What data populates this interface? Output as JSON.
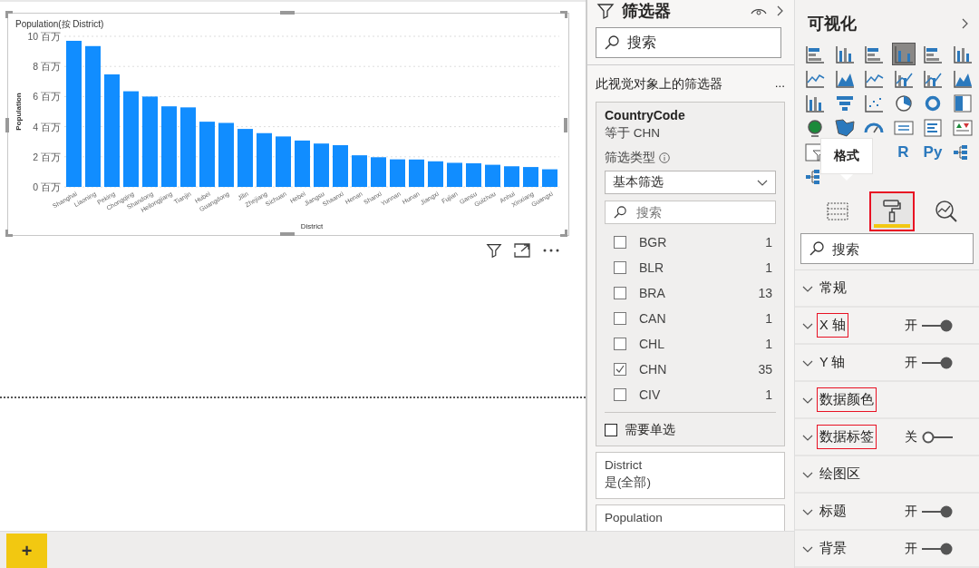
{
  "canvas": {
    "visual": {
      "title": "Population(按 District)",
      "chart_data": {
        "type": "bar",
        "grid": true,
        "xlabel": "District",
        "ylabel": "Population",
        "ylim": [
          0,
          10
        ],
        "yticks": [
          {
            "value": 0,
            "label": "0 百万"
          },
          {
            "value": 2,
            "label": "2 百万"
          },
          {
            "value": 4,
            "label": "4 百万"
          },
          {
            "value": 6,
            "label": "6 百万"
          },
          {
            "value": 8,
            "label": "8 百万"
          },
          {
            "value": 10,
            "label": "10 百万"
          }
        ],
        "categories": [
          "Shanghai",
          "Liaoning",
          "Peking",
          "Chongqing",
          "Shandong",
          "Heilongjiang",
          "Tianjin",
          "Hubei",
          "Guangdong",
          "Jilin",
          "Zhejiang",
          "Sichuan",
          "Hebei",
          "Jiangsu",
          "Shaanxi",
          "Henan",
          "Shanxi",
          "Yunnan",
          "Hunan",
          "Jiangxi",
          "Fujian",
          "Gansu",
          "Guizhou",
          "Anhui",
          "Xinxiang",
          "Guangxi"
        ],
        "series": [
          {
            "color": "#118dff",
            "values": [
              9.7,
              9.35,
              7.47,
              6.35,
              6.0,
              5.35,
              5.28,
              4.33,
              4.25,
              3.85,
              3.57,
              3.35,
              3.08,
              2.88,
              2.77,
              2.1,
              1.97,
              1.83,
              1.82,
              1.7,
              1.6,
              1.57,
              1.47,
              1.37,
              1.32,
              1.17
            ]
          }
        ]
      }
    }
  },
  "page_tabs": {
    "add_button": "+"
  },
  "filters": {
    "title": "筛选器",
    "search": {
      "placeholder": "搜索"
    },
    "section_title": "此视觉对象上的筛选器",
    "section_more": "...",
    "cards": [
      {
        "kind": "expanded",
        "field": "CountryCode",
        "summary": "等于 CHN",
        "filter_type_label": "筛选类型",
        "filter_type": "基本筛选",
        "search": {
          "placeholder": "搜索"
        },
        "items": [
          {
            "label": "BGR",
            "count": "1",
            "checked": false
          },
          {
            "label": "BLR",
            "count": "1",
            "checked": false
          },
          {
            "label": "BRA",
            "count": "13",
            "checked": false
          },
          {
            "label": "CAN",
            "count": "1",
            "checked": false
          },
          {
            "label": "CHL",
            "count": "1",
            "checked": false
          },
          {
            "label": "CHN",
            "count": "35",
            "checked": true
          },
          {
            "label": "CIV",
            "count": "1",
            "checked": false
          }
        ],
        "single_select": {
          "label": "需要单选",
          "checked": false
        }
      },
      {
        "kind": "collapsed",
        "field": "District",
        "summary": "是(全部)"
      },
      {
        "kind": "collapsed",
        "field": "Population"
      }
    ]
  },
  "visualizations": {
    "title": "可视化",
    "gallery": [
      {
        "kind": "hbar",
        "selected": false
      },
      {
        "kind": "vbar",
        "selected": false
      },
      {
        "kind": "hbar",
        "selected": false
      },
      {
        "kind": "vbar",
        "selected": true
      },
      {
        "kind": "hbar",
        "selected": false
      },
      {
        "kind": "vbar",
        "selected": false
      },
      {
        "kind": "line",
        "selected": false
      },
      {
        "kind": "area",
        "selected": false
      },
      {
        "kind": "line",
        "selected": false
      },
      {
        "kind": "combo",
        "selected": false
      },
      {
        "kind": "combo",
        "selected": false
      },
      {
        "kind": "area",
        "selected": false
      },
      {
        "kind": "vbar",
        "selected": false
      },
      {
        "kind": "funnel",
        "selected": false
      },
      {
        "kind": "scatter",
        "selected": false
      },
      {
        "kind": "pie",
        "selected": false
      },
      {
        "kind": "donut",
        "selected": false
      },
      {
        "kind": "treemap",
        "selected": false
      },
      {
        "kind": "globe",
        "selected": false
      },
      {
        "kind": "map",
        "selected": false
      },
      {
        "kind": "gauge",
        "selected": false
      },
      {
        "kind": "card",
        "selected": false
      },
      {
        "kind": "list",
        "selected": false
      },
      {
        "kind": "kpi",
        "selected": false
      },
      {
        "kind": "table",
        "selected": false
      },
      {
        "kind": "tooltip",
        "text": "格式"
      },
      {
        "kind": "blank"
      },
      {
        "kind": "text",
        "text": "R",
        "selected": false
      },
      {
        "kind": "text",
        "text": "Py",
        "selected": false
      },
      {
        "kind": "tree",
        "selected": false
      },
      {
        "kind": "tree",
        "selected": false
      }
    ],
    "tabs": [
      {
        "kind": "fields",
        "selected": false,
        "highlighted": false
      },
      {
        "kind": "format",
        "selected": true,
        "highlighted": true
      },
      {
        "kind": "analytics",
        "selected": false,
        "highlighted": false
      }
    ],
    "search": {
      "placeholder": "搜索"
    },
    "sections": [
      {
        "label": "常规",
        "highlighted": false
      },
      {
        "label": "X 轴",
        "highlighted": true,
        "toggle": {
          "text": "开",
          "on": true
        }
      },
      {
        "label": "Y 轴",
        "highlighted": false,
        "toggle": {
          "text": "开",
          "on": true
        }
      },
      {
        "label": "数据颜色",
        "highlighted": true
      },
      {
        "label": "数据标签",
        "highlighted": true,
        "toggle": {
          "text": "关",
          "on": false
        }
      },
      {
        "label": "绘图区",
        "highlighted": false
      },
      {
        "label": "标题",
        "highlighted": false,
        "toggle": {
          "text": "开",
          "on": true
        }
      },
      {
        "label": "背景",
        "highlighted": false,
        "toggle": {
          "text": "开",
          "on": true
        }
      }
    ]
  }
}
